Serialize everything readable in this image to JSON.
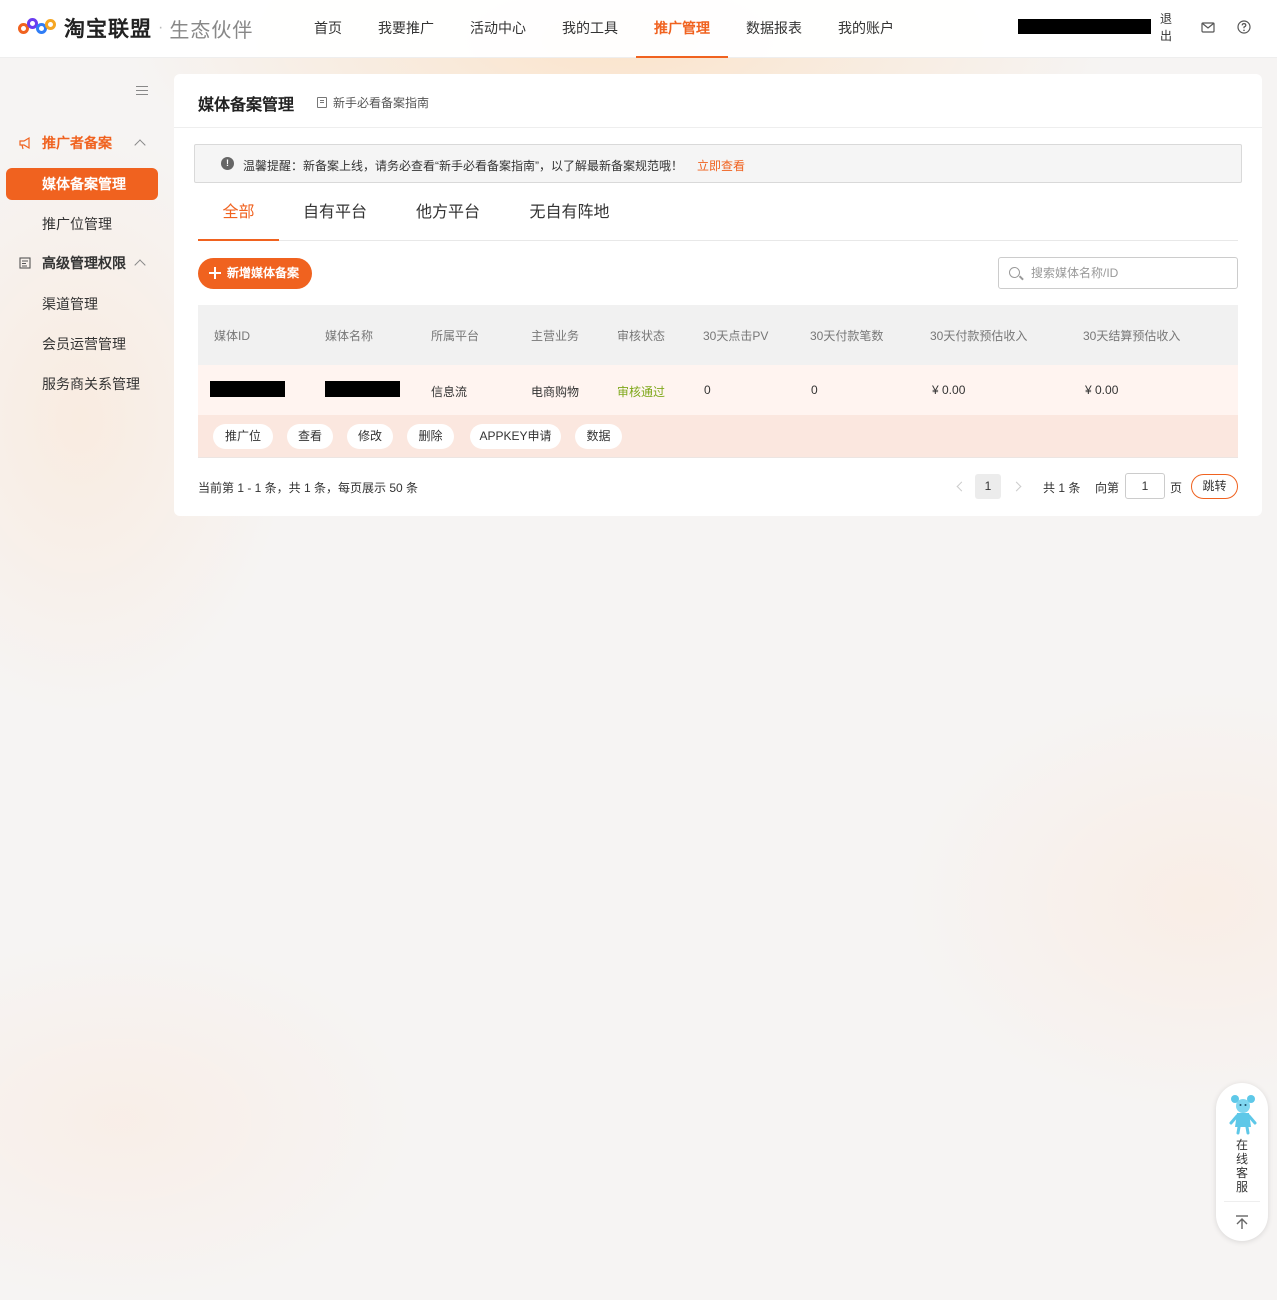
{
  "header": {
    "brand": "淘宝联盟",
    "brand_separator": "·",
    "brand_sub": "生态伙伴",
    "nav": [
      "首页",
      "我要推广",
      "活动中心",
      "我的工具",
      "推广管理",
      "数据报表",
      "我的账户"
    ],
    "active_nav": "推广管理",
    "logout_line1": "退",
    "logout_line2": "出",
    "icons": [
      "mail-icon",
      "help-icon"
    ]
  },
  "sidebar": {
    "groups": [
      {
        "label": "推广者备案",
        "icon": "megaphone-icon",
        "expanded": true
      },
      {
        "label": "高级管理权限",
        "icon": "admin-icon",
        "expanded": true
      }
    ],
    "items": [
      "媒体备案管理",
      "推广位管理",
      "渠道管理",
      "会员运营管理",
      "服务商关系管理"
    ],
    "active_item": "媒体备案管理"
  },
  "main": {
    "title": "媒体备案管理",
    "guide_link": "新手必看备案指南",
    "notice": {
      "text": "温馨提醒：新备案上线，请务必查看“新手必看备案指南”，以了解最新备案规范哦！",
      "link": "立即查看"
    },
    "tabs": [
      "全部",
      "自有平台",
      "他方平台",
      "无自有阵地"
    ],
    "active_tab": "全部",
    "add_button": "新增媒体备案",
    "search": {
      "placeholder": "搜索媒体名称/ID",
      "value": ""
    },
    "table": {
      "headers": [
        "媒体ID",
        "媒体名称",
        "所属平台",
        "主营业务",
        "审核状态",
        "30天点击PV",
        "30天付款笔数",
        "30天付款预估收入",
        "30天结算预估收入"
      ],
      "rows": [
        {
          "media_id": "",
          "media_name": "",
          "platform": "信息流",
          "business": "电商购物",
          "status": "审核通过",
          "pv_30d": "0",
          "orders_30d": "0",
          "pay_income_30d": "¥ 0.00",
          "settle_income_30d": "¥ 0.00",
          "actions": [
            "推广位",
            "查看",
            "修改",
            "删除",
            "APPKEY申请",
            "数据"
          ]
        }
      ]
    },
    "pagination": {
      "summary": "当前第 1 - 1 条，共 1 条，每页展示 50 条",
      "current_page": "1",
      "total": "共 1 条",
      "goto_prefix": "向第",
      "goto_value": "1",
      "goto_suffix": "页",
      "jump_button": "跳转"
    }
  },
  "float_service": {
    "label": [
      "在",
      "线",
      "客",
      "服"
    ],
    "icons": [
      "mascot-icon",
      "back-to-top-icon"
    ]
  },
  "colors": {
    "accent": "#f0621f",
    "status_ok": "#7fa81b",
    "action_row_bg": "#fbe7df"
  }
}
